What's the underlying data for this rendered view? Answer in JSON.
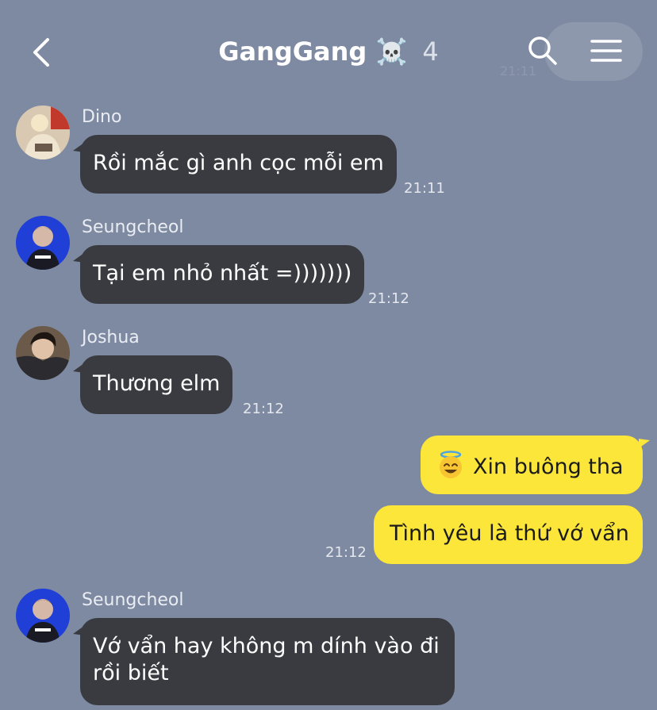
{
  "header": {
    "title": "GangGang",
    "title_emoji": "☠️",
    "member_count": "4",
    "ghost_time": "21:11"
  },
  "messages": [
    {
      "sender": "Dino",
      "text": "Rồi mắc gì anh cọc mỗi em",
      "time": "21:11"
    },
    {
      "sender": "Seungcheol",
      "text": "Tại em nhỏ nhất =)))))))",
      "time": "21:12"
    },
    {
      "sender": "Joshua",
      "text": "Thương elm",
      "time": "21:12"
    },
    {
      "text": "Xin buông tha",
      "emoji": "smiling-face-with-halo"
    },
    {
      "text": "Tình yêu là thứ vớ vẩn",
      "time": "21:12"
    },
    {
      "sender": "Seungcheol",
      "text_line1": "Vớ vẩn hay không m dính vào đi",
      "text_line2": "rồi biết"
    }
  ],
  "colors": {
    "background": "#7e8aa1",
    "incoming_bubble": "#3a3b40",
    "outgoing_bubble": "#fde63a"
  }
}
